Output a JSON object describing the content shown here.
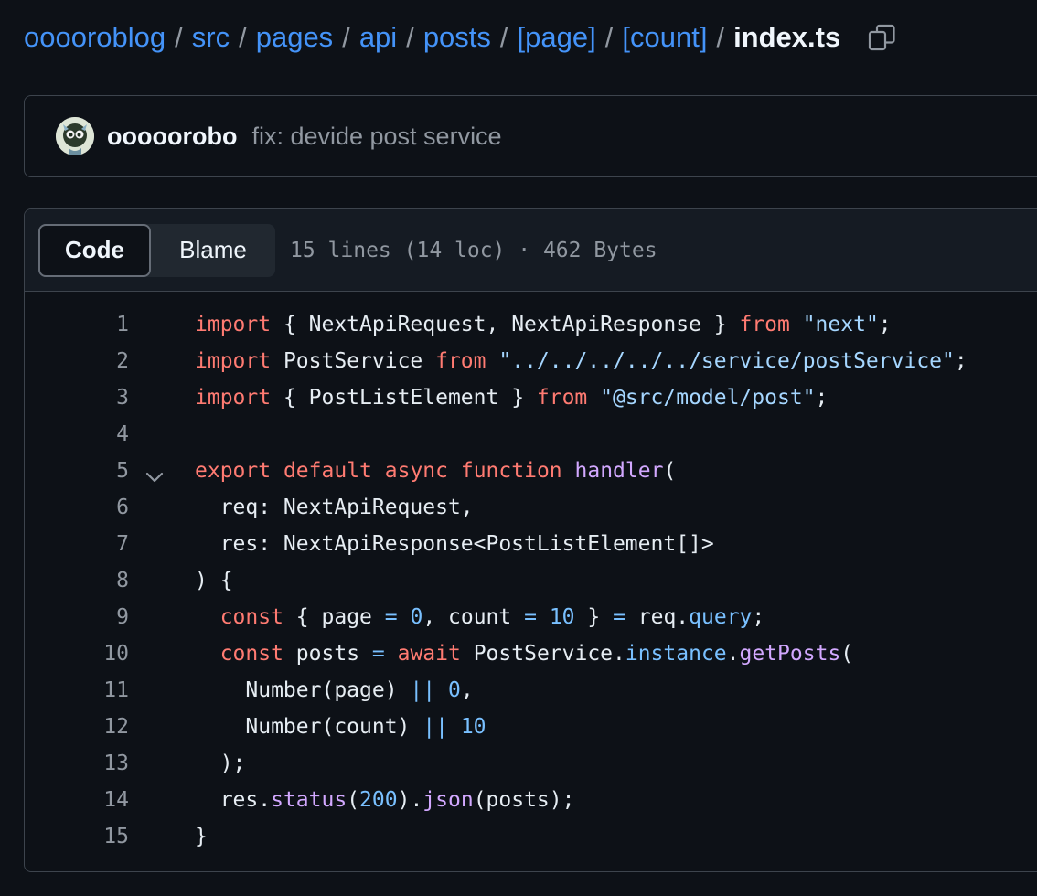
{
  "breadcrumb": {
    "items": [
      "ooooroblog",
      "src",
      "pages",
      "api",
      "posts",
      "[page]",
      "[count]"
    ],
    "current": "index.ts",
    "separator": "/"
  },
  "icons": {
    "copy": "copy-path-icon",
    "avatar": "user-avatar",
    "fold": "chevron-down-icon"
  },
  "commit": {
    "author": "ooooorobo",
    "message": "fix: devide post service"
  },
  "file": {
    "tabs": [
      {
        "label": "Code",
        "active": true
      },
      {
        "label": "Blame",
        "active": false
      }
    ],
    "meta": "15 lines (14 loc) · 462 Bytes"
  },
  "colors": {
    "background": "#0d1117",
    "link": "#4493f8",
    "keyword": "#ff7b72",
    "string": "#a5d6ff",
    "function": "#d2a8ff",
    "number": "#79c0ff",
    "muted": "#9198a1"
  },
  "code": {
    "lines": [
      {
        "n": "1",
        "tokens": [
          [
            "kw",
            "import"
          ],
          [
            "id",
            " { NextApiRequest, NextApiResponse } "
          ],
          [
            "kw",
            "from"
          ],
          [
            "id",
            " "
          ],
          [
            "str",
            "\"next\""
          ],
          [
            "id",
            ";"
          ]
        ]
      },
      {
        "n": "2",
        "tokens": [
          [
            "kw",
            "import"
          ],
          [
            "id",
            " PostService "
          ],
          [
            "kw",
            "from"
          ],
          [
            "id",
            " "
          ],
          [
            "str",
            "\"../../../../../service/postService\""
          ],
          [
            "id",
            ";"
          ]
        ]
      },
      {
        "n": "3",
        "tokens": [
          [
            "kw",
            "import"
          ],
          [
            "id",
            " { PostListElement } "
          ],
          [
            "kw",
            "from"
          ],
          [
            "id",
            " "
          ],
          [
            "str",
            "\"@src/model/post\""
          ],
          [
            "id",
            ";"
          ]
        ]
      },
      {
        "n": "4",
        "tokens": []
      },
      {
        "n": "5",
        "fold": true,
        "tokens": [
          [
            "kw",
            "export"
          ],
          [
            "id",
            " "
          ],
          [
            "kw",
            "default"
          ],
          [
            "id",
            " "
          ],
          [
            "kw",
            "async"
          ],
          [
            "id",
            " "
          ],
          [
            "kw",
            "function"
          ],
          [
            "id",
            " "
          ],
          [
            "fn",
            "handler"
          ],
          [
            "id",
            "("
          ]
        ]
      },
      {
        "n": "6",
        "tokens": [
          [
            "id",
            "  req: NextApiRequest,"
          ]
        ]
      },
      {
        "n": "7",
        "tokens": [
          [
            "id",
            "  res: NextApiResponse<PostListElement[]>"
          ]
        ]
      },
      {
        "n": "8",
        "tokens": [
          [
            "id",
            ") {"
          ]
        ]
      },
      {
        "n": "9",
        "tokens": [
          [
            "id",
            "  "
          ],
          [
            "kw",
            "const"
          ],
          [
            "id",
            " { page "
          ],
          [
            "op",
            "="
          ],
          [
            "id",
            " "
          ],
          [
            "num",
            "0"
          ],
          [
            "id",
            ", count "
          ],
          [
            "op",
            "="
          ],
          [
            "id",
            " "
          ],
          [
            "num",
            "10"
          ],
          [
            "id",
            " } "
          ],
          [
            "op",
            "="
          ],
          [
            "id",
            " req."
          ],
          [
            "prop",
            "query"
          ],
          [
            "id",
            ";"
          ]
        ]
      },
      {
        "n": "10",
        "tokens": [
          [
            "id",
            "  "
          ],
          [
            "kw",
            "const"
          ],
          [
            "id",
            " posts "
          ],
          [
            "op",
            "="
          ],
          [
            "id",
            " "
          ],
          [
            "kw",
            "await"
          ],
          [
            "id",
            " PostService."
          ],
          [
            "prop",
            "instance"
          ],
          [
            "id",
            "."
          ],
          [
            "fn",
            "getPosts"
          ],
          [
            "id",
            "("
          ]
        ]
      },
      {
        "n": "11",
        "tokens": [
          [
            "id",
            "    Number(page) "
          ],
          [
            "op",
            "||"
          ],
          [
            "id",
            " "
          ],
          [
            "num",
            "0"
          ],
          [
            "id",
            ","
          ]
        ]
      },
      {
        "n": "12",
        "tokens": [
          [
            "id",
            "    Number(count) "
          ],
          [
            "op",
            "||"
          ],
          [
            "id",
            " "
          ],
          [
            "num",
            "10"
          ]
        ]
      },
      {
        "n": "13",
        "tokens": [
          [
            "id",
            "  );"
          ]
        ]
      },
      {
        "n": "14",
        "tokens": [
          [
            "id",
            "  res."
          ],
          [
            "fn",
            "status"
          ],
          [
            "id",
            "("
          ],
          [
            "num",
            "200"
          ],
          [
            "id",
            ")."
          ],
          [
            "fn",
            "json"
          ],
          [
            "id",
            "(posts);"
          ]
        ]
      },
      {
        "n": "15",
        "tokens": [
          [
            "id",
            "}"
          ]
        ]
      }
    ]
  }
}
